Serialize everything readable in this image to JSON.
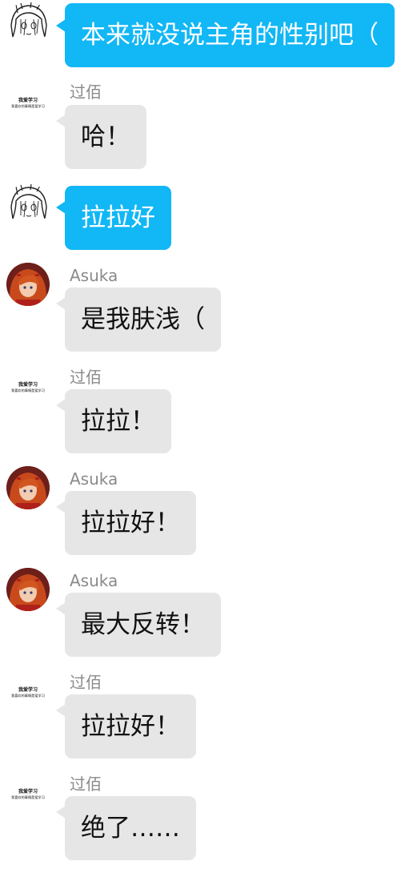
{
  "messages": [
    {
      "sender": "",
      "role": "self",
      "avatar": "sketch-girl-avatar",
      "text": "本来就没说主角的性别吧（"
    },
    {
      "sender": "过佰",
      "role": "other",
      "avatar": "text-logo-avatar",
      "avatar_text_1": "我爱学习",
      "avatar_text_2": "我喜欢的事情是爱学习",
      "text": "哈！"
    },
    {
      "sender": "",
      "role": "self",
      "avatar": "sketch-girl-avatar",
      "text": "拉拉好"
    },
    {
      "sender": "Asuka",
      "role": "other",
      "avatar": "asuka-avatar",
      "text": "是我肤浅（"
    },
    {
      "sender": "过佰",
      "role": "other",
      "avatar": "text-logo-avatar",
      "avatar_text_1": "我爱学习",
      "avatar_text_2": "我喜欢的事情是爱学习",
      "text": "拉拉！"
    },
    {
      "sender": "Asuka",
      "role": "other",
      "avatar": "asuka-avatar",
      "text": "拉拉好！"
    },
    {
      "sender": "Asuka",
      "role": "other",
      "avatar": "asuka-avatar",
      "text": "最大反转！"
    },
    {
      "sender": "过佰",
      "role": "other",
      "avatar": "text-logo-avatar",
      "avatar_text_1": "我爱学习",
      "avatar_text_2": "我喜欢的事情是爱学习",
      "text": "拉拉好！"
    },
    {
      "sender": "过佰",
      "role": "other",
      "avatar": "text-logo-avatar",
      "avatar_text_1": "我爱学习",
      "avatar_text_2": "我喜欢的事情是爱学习",
      "text": "绝了……"
    }
  ],
  "colors": {
    "self_bubble": "#12b7f5",
    "other_bubble": "#e6e6e6",
    "sender_name": "#8a8a8a"
  }
}
